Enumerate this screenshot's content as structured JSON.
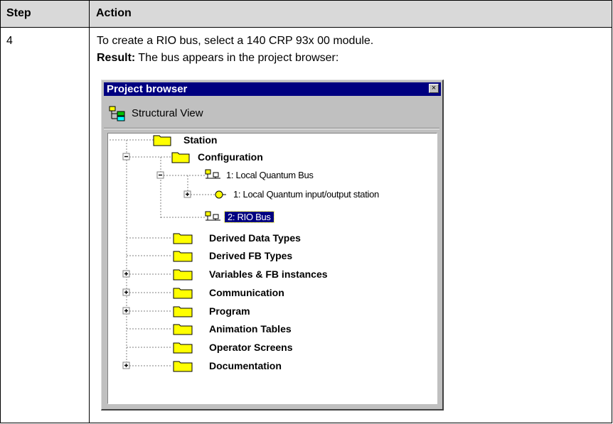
{
  "table": {
    "headers": {
      "step": "Step",
      "action": "Action"
    },
    "row": {
      "step": "4",
      "line1": "To create a RIO bus, select a 140 CRP 93x 00 module.",
      "result_label": "Result:",
      "result_text": " The bus appears in the project browser:"
    }
  },
  "window": {
    "title": "Project browser",
    "close_glyph": "×",
    "view_label": "Structural View",
    "tree": {
      "station": "Station",
      "configuration": "Configuration",
      "local_bus": "1: Local Quantum Bus",
      "local_station": "1: Local Quantum input/output station",
      "rio_bus": "2: RIO Bus",
      "derived_data_types": "Derived Data Types",
      "derived_fb_types": "Derived FB Types",
      "variables": "Variables & FB instances",
      "communication": "Communication",
      "program": "Program",
      "animation_tables": "Animation Tables",
      "operator_screens": "Operator Screens",
      "documentation": "Documentation"
    }
  },
  "colors": {
    "header_bg": "#d9d9d9",
    "titlebar": "#000080",
    "folder_fill": "#ffff00",
    "selection": "#000080"
  }
}
